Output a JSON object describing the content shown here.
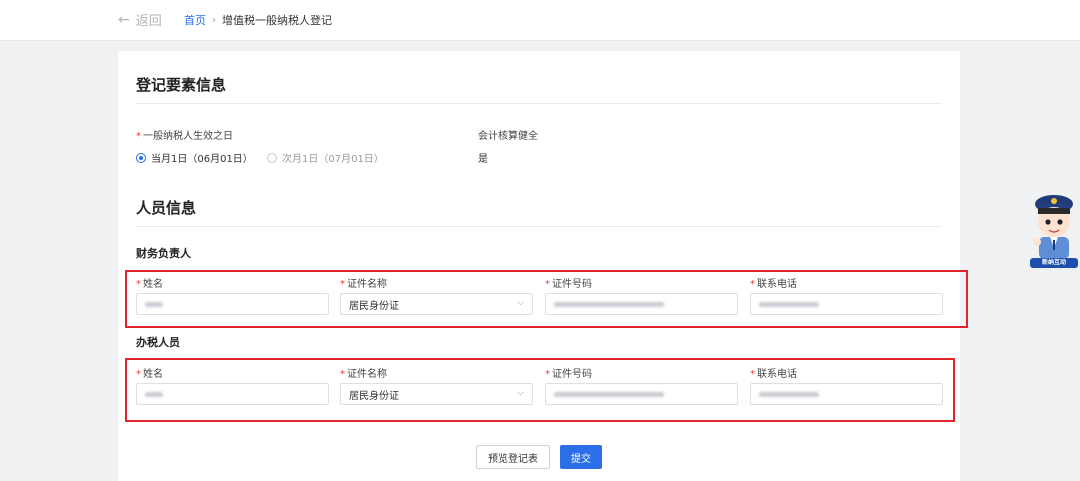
{
  "header": {
    "back_label": "返回",
    "breadcrumb_home": "首页",
    "breadcrumb_current": "增值税一般纳税人登记"
  },
  "registration": {
    "title": "登记要素信息",
    "effective_date_label": "一般纳税人生效之日",
    "option1": "当月1日（06月01日）",
    "option2": "次月1日（07月01日）",
    "accounting_label": "会计核算健全",
    "accounting_value": "是"
  },
  "personnel": {
    "title": "人员信息",
    "finance": {
      "title": "财务负责人",
      "name_label": "姓名",
      "id_type_label": "证件名称",
      "id_type_value": "居民身份证",
      "id_number_label": "证件号码",
      "phone_label": "联系电话"
    },
    "tax_officer": {
      "title": "办税人员",
      "name_label": "姓名",
      "id_type_label": "证件名称",
      "id_type_value": "居民身份证",
      "id_number_label": "证件号码",
      "phone_label": "联系电话"
    }
  },
  "actions": {
    "preview_label": "预览登记表",
    "submit_label": "提交"
  },
  "colors": {
    "primary": "#2c6ee6",
    "required": "#e23c3c",
    "highlight": "#e0242b"
  },
  "mascot_badge": "新纳互动"
}
